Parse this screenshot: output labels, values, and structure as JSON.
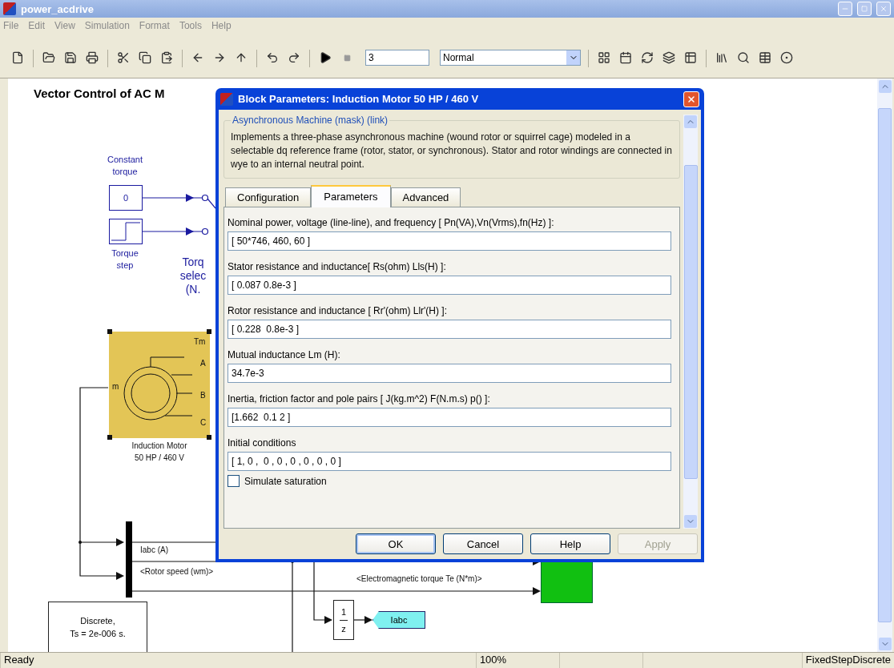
{
  "window": {
    "title": "power_acdrive"
  },
  "menu": [
    "File",
    "Edit",
    "View",
    "Simulation",
    "Format",
    "Tools",
    "Help"
  ],
  "toolbar": {
    "stop_time": "3",
    "mode": "Normal"
  },
  "canvas": {
    "title": "Vector Control of AC M",
    "constant_block": {
      "label": [
        "Constant",
        "torque"
      ],
      "value": "0"
    },
    "step_block": {
      "label": [
        "Torque",
        "step"
      ]
    },
    "selector_label": [
      "Torq",
      "selec",
      "(N."
    ],
    "motor_block": {
      "ports": [
        "Tm",
        "A",
        "B",
        "C",
        "m"
      ],
      "label": [
        "Induction Motor",
        "50 HP / 460 V"
      ]
    },
    "signals": [
      "Iabc (A)",
      "<Rotor speed (wm)>",
      "<Electromagnetic torque Te (N*m)>"
    ],
    "discrete_block": [
      "Discrete,",
      "Ts = 2e-006 s."
    ],
    "delay_block": {
      "numerator": "1",
      "denominator": "z"
    },
    "goto_tag": "Iabc"
  },
  "dialog": {
    "title": "Block Parameters: Induction Motor 50 HP / 460 V",
    "group": "Asynchronous Machine (mask) (link)",
    "description": "Implements a three-phase asynchronous machine (wound rotor or squirrel cage) modeled in a selectable  dq reference frame (rotor, stator, or synchronous). Stator and rotor windings are connected in wye to an internal neutral point.",
    "tabs": [
      {
        "label": "Configuration",
        "selected": false
      },
      {
        "label": "Parameters",
        "selected": true
      },
      {
        "label": "Advanced",
        "selected": false
      }
    ],
    "parameters": [
      {
        "label": "Nominal power, voltage (line-line), and frequency [ Pn(VA),Vn(Vrms),fn(Hz) ]:",
        "value": "[ 50*746, 460, 60 ]"
      },
      {
        "label": "Stator resistance and inductance[ Rs(ohm)  Lls(H) ]:",
        "value": "[ 0.087 0.8e-3 ]"
      },
      {
        "label": "Rotor resistance and inductance [ Rr'(ohm)  Llr'(H) ]:",
        "value": "[ 0.228  0.8e-3 ]"
      },
      {
        "label": "Mutual inductance Lm (H):",
        "value": "34.7e-3"
      },
      {
        "label": "Inertia, friction factor and pole pairs [ J(kg.m^2)  F(N.m.s)  p() ]:",
        "value": "[1.662  0.1 2 ]"
      },
      {
        "label": "Initial conditions",
        "value": "[ 1, 0 ,  0 , 0 , 0 , 0 , 0 , 0 ]"
      }
    ],
    "checkbox": {
      "label": "Simulate saturation",
      "checked": false
    },
    "buttons": [
      {
        "label": "OK",
        "disabled": false,
        "default": true
      },
      {
        "label": "Cancel",
        "disabled": false,
        "default": false
      },
      {
        "label": "Help",
        "disabled": false,
        "default": false
      },
      {
        "label": "Apply",
        "disabled": true,
        "default": false
      }
    ]
  },
  "status_bar": {
    "message": "Ready",
    "zoom": "100%",
    "solver": "FixedStepDiscrete"
  }
}
